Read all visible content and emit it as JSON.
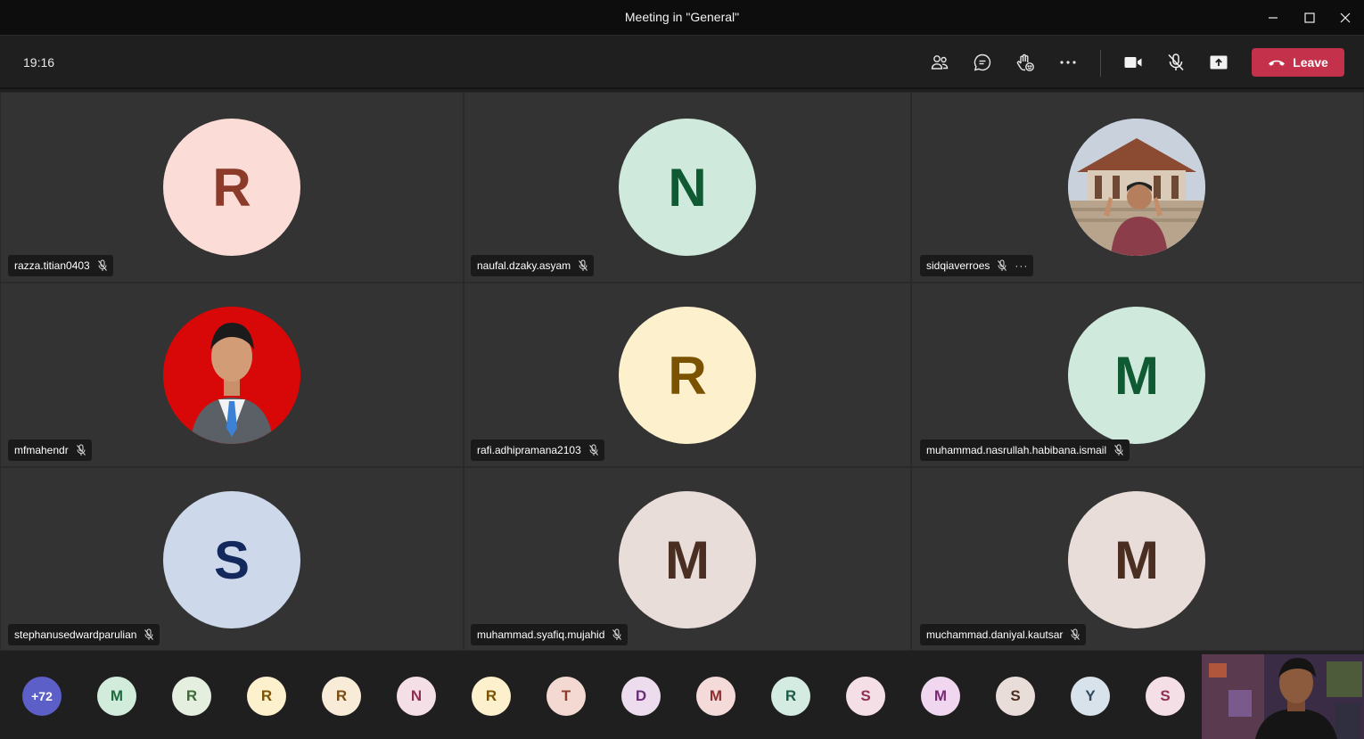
{
  "window": {
    "title": "Meeting in \"General\""
  },
  "toolbar": {
    "time": "19:16",
    "leave_label": "Leave"
  },
  "tiles": [
    {
      "name": "razza.titian0403",
      "initial": "R",
      "bg": "#fbdcd6",
      "fg": "#8c3a2a"
    },
    {
      "name": "naufal.dzaky.asyam",
      "initial": "N",
      "bg": "#cfeadc",
      "fg": "#0f5a33"
    },
    {
      "name": "sidqiaverroes",
      "photo": true,
      "more_menu": "···"
    },
    {
      "name": "mfmahendr",
      "photo": true
    },
    {
      "name": "rafi.adhipramana2103",
      "initial": "R",
      "bg": "#fdf0cd",
      "fg": "#7a5200"
    },
    {
      "name": "muhammad.nasrullah.habibana.ismail",
      "initial": "M",
      "bg": "#cfeadc",
      "fg": "#0f5a33"
    },
    {
      "name": "stephanusedwardparulian",
      "initial": "S",
      "bg": "#cdd8eb",
      "fg": "#13285c"
    },
    {
      "name": "muhammad.syafiq.mujahid",
      "initial": "M",
      "bg": "#e8ddd8",
      "fg": "#4a2e22"
    },
    {
      "name": "muchammad.daniyal.kautsar",
      "initial": "M",
      "bg": "#e8ddd8",
      "fg": "#4a2e22"
    }
  ],
  "overflow_count": "+72",
  "strip": [
    {
      "initial": "M",
      "bg": "#d2ecdc",
      "fg": "#1f6b40"
    },
    {
      "initial": "R",
      "bg": "#e4efe0",
      "fg": "#3f6b36"
    },
    {
      "initial": "R",
      "bg": "#fdf0cd",
      "fg": "#7a5200"
    },
    {
      "initial": "R",
      "bg": "#f8ecd8",
      "fg": "#7a4e10"
    },
    {
      "initial": "N",
      "bg": "#f5dfe6",
      "fg": "#8e2e52"
    },
    {
      "initial": "R",
      "bg": "#fdf0cd",
      "fg": "#7a5200"
    },
    {
      "initial": "T",
      "bg": "#f4d9d3",
      "fg": "#8c3a2a"
    },
    {
      "initial": "D",
      "bg": "#ecdcee",
      "fg": "#6b2f78"
    },
    {
      "initial": "M",
      "bg": "#f5dada",
      "fg": "#8c2f2f"
    },
    {
      "initial": "R",
      "bg": "#d4ebe2",
      "fg": "#1f5a47"
    },
    {
      "initial": "S",
      "bg": "#f5dfe6",
      "fg": "#8e2e52"
    },
    {
      "initial": "M",
      "bg": "#f0d6ee",
      "fg": "#7a2a74"
    },
    {
      "initial": "S",
      "bg": "#e8ddd8",
      "fg": "#4a2e22"
    },
    {
      "initial": "Y",
      "bg": "#d8e2ea",
      "fg": "#2f4a5e"
    },
    {
      "initial": "S",
      "bg": "#f5dfe6",
      "fg": "#8e2e52"
    }
  ]
}
